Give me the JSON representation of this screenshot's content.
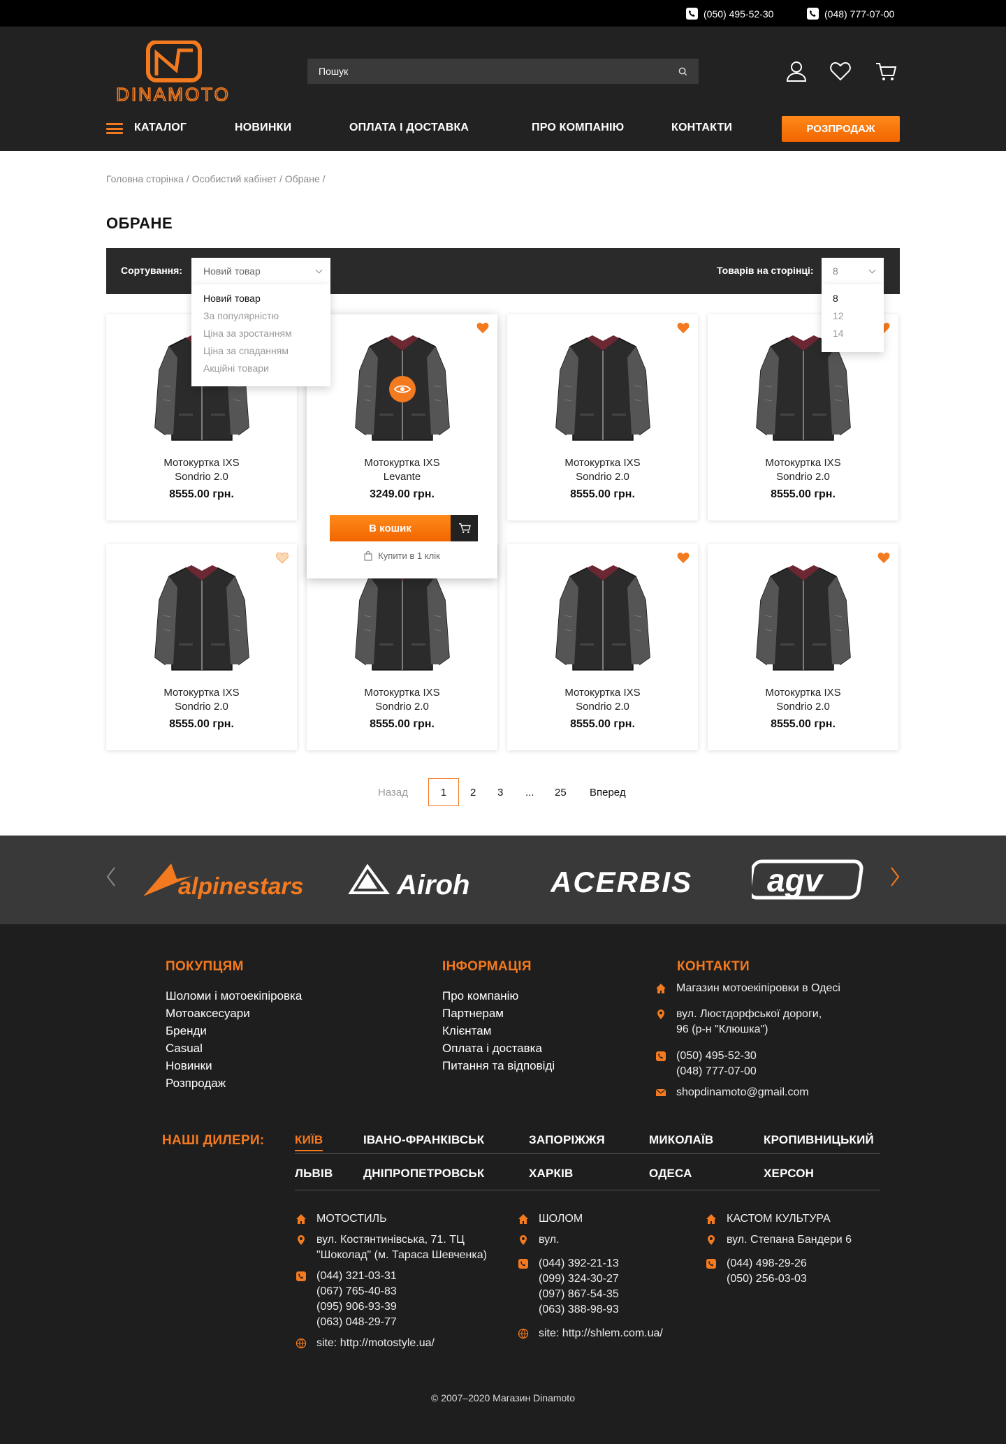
{
  "topbar": {
    "phones": [
      "(050) 495-52-30",
      "(048) 777-07-00"
    ]
  },
  "header": {
    "logo_text": "DINAMOTO",
    "search_placeholder": "Пошук",
    "nav": {
      "catalog": "КАТАЛОГ",
      "new": "НОВИНКИ",
      "payment": "ОПЛАТА І ДОСТАВКА",
      "about": "ПРО КОМПАНІЮ",
      "contacts": "КОНТАКТИ",
      "sale": "РОЗПРОДАЖ"
    },
    "accent_color": "#f47a1f"
  },
  "breadcrumbs": "Головна сторінка / Особистий кабінет / Обране /",
  "page_title": "ОБРАНЕ",
  "sorting": {
    "label": "Сортування:",
    "selected": "Новий товар",
    "options": [
      "Новий товар",
      "За популярністю",
      "Ціна за зростанням",
      "Ціна за спаданням",
      "Акційні товари"
    ],
    "per_page_label": "Товарів на сторінці:",
    "per_page_selected": "8",
    "per_page_options": [
      "8",
      "12",
      "14"
    ]
  },
  "products": [
    {
      "name1": "Мотокуртка IXS",
      "name2": "Sondrio 2.0",
      "price": "8555.00 грн."
    },
    {
      "name1": "Мотокуртка IXS",
      "name2": "Levante",
      "price": "3249.00 грн.",
      "cart_label": "В кошик",
      "one_click": "Купити в 1 клік"
    },
    {
      "name1": "Мотокуртка IXS",
      "name2": "Sondrio 2.0",
      "price": "8555.00 грн."
    },
    {
      "name1": "Мотокуртка IXS",
      "name2": "Sondrio 2.0",
      "price": "8555.00 грн."
    },
    {
      "name1": "Мотокуртка IXS",
      "name2": "Sondrio 2.0",
      "price": "8555.00 грн."
    },
    {
      "name1": "Мотокуртка IXS",
      "name2": "Sondrio 2.0",
      "price": "8555.00 грн."
    },
    {
      "name1": "Мотокуртка IXS",
      "name2": "Sondrio 2.0",
      "price": "8555.00 грн."
    },
    {
      "name1": "Мотокуртка IXS",
      "name2": "Sondrio 2.0",
      "price": "8555.00 грн."
    }
  ],
  "pagination": {
    "prev": "Назад",
    "pages": [
      "1",
      "2",
      "3",
      "...",
      "25"
    ],
    "next": "Вперед",
    "current": "1"
  },
  "brands": [
    "alpinestars",
    "Airoh",
    "ACERBIS",
    "agv"
  ],
  "footer": {
    "buyers": {
      "title": "ПОКУПЦЯМ",
      "links": [
        "Шоломи і мотоекіпіровка",
        "Мотоаксесуари",
        "Бренди",
        "Casual",
        "Новинки",
        "Розпродаж"
      ]
    },
    "info": {
      "title": "ІНФОРМАЦІЯ",
      "links": [
        "Про компанію",
        "Партнерам",
        "Клієнтам",
        "Оплата і доставка",
        "Питання та відповіді"
      ]
    },
    "contacts": {
      "title": "КОНТАКТИ",
      "shop": "Магазин мотоекіпіровки в Одесі",
      "address1": "вул. Люстдорфської дороги,",
      "address2": "96 (р-н \"Клюшка\")",
      "phone1": "(050) 495-52-30",
      "phone2": "(048) 777-07-00",
      "email": "shopdinamoto@gmail.com"
    },
    "dealers_title": "НАШІ ДИЛЕРИ:",
    "cities_row1": [
      "КИЇВ",
      "ІВАНО-ФРАНКІВСЬК",
      "ЗАПОРІЖЖЯ",
      "МИКОЛАЇВ",
      "КРОПИВНИЦЬКИЙ"
    ],
    "cities_row2": [
      "ЛЬВІВ",
      "ДНІПРОПЕТРОВСЬК",
      "ХАРКІВ",
      "ОДЕСА",
      "ХЕРСОН"
    ],
    "dealers": [
      {
        "name": "МОТОСТИЛЬ",
        "address": [
          "вул. Костянтинівська, 71. ТЦ",
          "\"Шоколад\" (м. Тараса Шевченка)"
        ],
        "phones": [
          "(044) 321-03-31",
          "(067) 765-40-83",
          "(095) 906-93-39",
          "(063) 048-29-77"
        ],
        "site": "site: http://motostyle.ua/"
      },
      {
        "name": "ШОЛОМ",
        "address": [
          "вул."
        ],
        "phones": [
          "(044) 392-21-13",
          "(099) 324-30-27",
          "(097) 867-54-35",
          "(063) 388-98-93"
        ],
        "site": "site: http://shlem.com.ua/"
      },
      {
        "name": "КАСТОМ КУЛЬТУРА",
        "address": [
          "вул. Степана Бандери 6"
        ],
        "phones": [
          "(044) 498-29-26",
          "(050) 256-03-03"
        ]
      }
    ],
    "copyright": "© 2007–2020 Магазин Dinamoto"
  }
}
